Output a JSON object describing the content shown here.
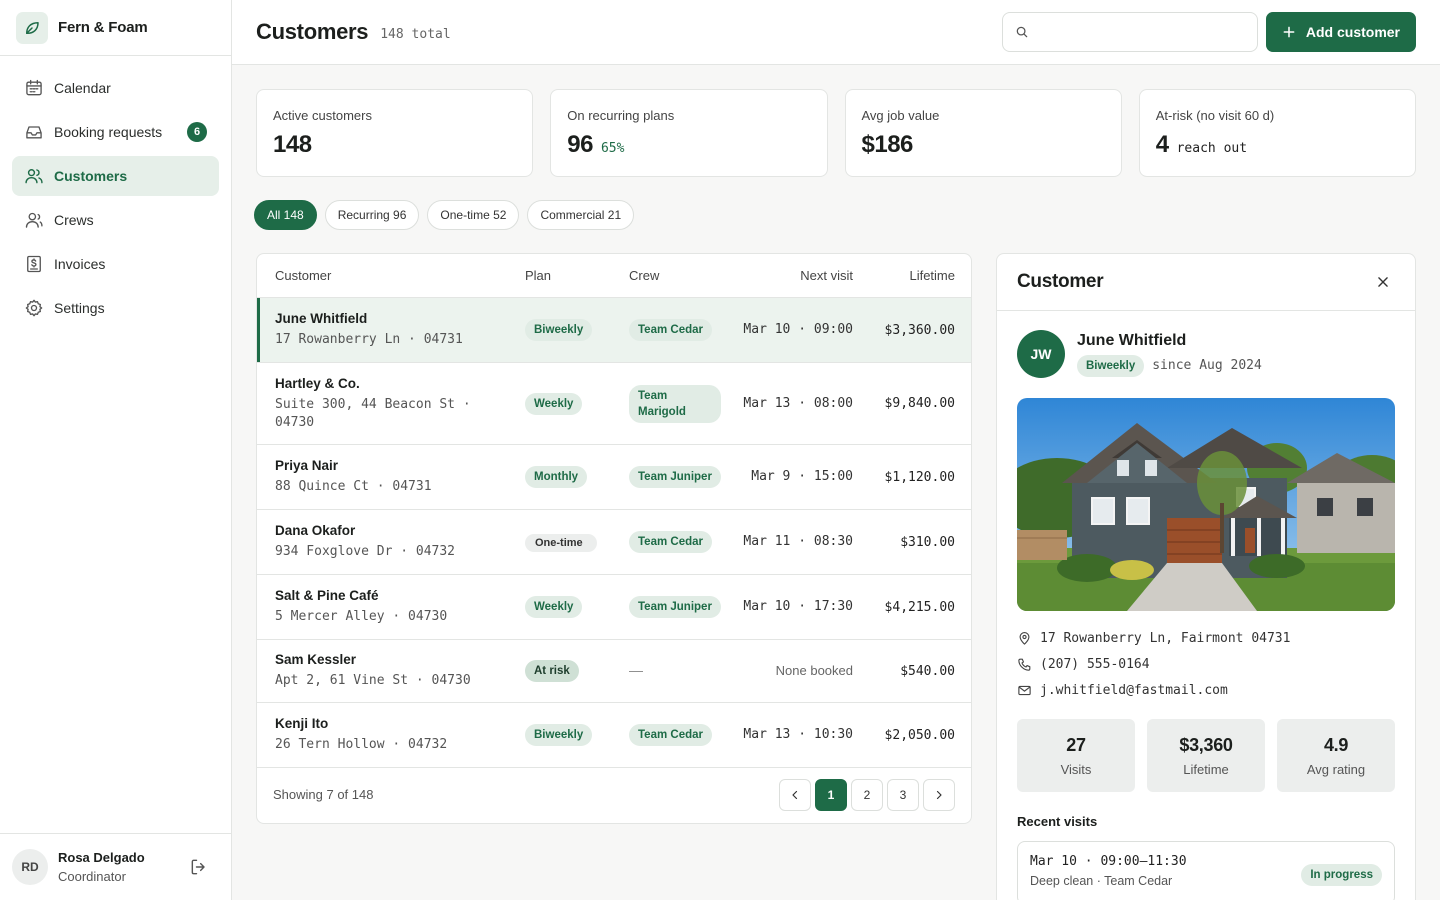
{
  "brand": {
    "name": "Fern & Foam"
  },
  "nav": [
    {
      "label": "Calendar",
      "icon": "calendar-icon"
    },
    {
      "label": "Booking requests",
      "icon": "inbox-icon",
      "badge": "6"
    },
    {
      "label": "Customers",
      "icon": "users-icon",
      "active": true
    },
    {
      "label": "Crews",
      "icon": "crew-icon"
    },
    {
      "label": "Invoices",
      "icon": "invoice-icon"
    },
    {
      "label": "Settings",
      "icon": "gear-icon"
    }
  ],
  "user": {
    "initials": "RD",
    "name": "Rosa Delgado",
    "role": "Coordinator"
  },
  "header": {
    "title": "Customers",
    "count": "148 total",
    "search_placeholder": "",
    "add_label": "Add customer"
  },
  "stats": [
    {
      "label": "Active customers",
      "value": "148",
      "sub": ""
    },
    {
      "label": "On recurring plans",
      "value": "96",
      "sub": "65%"
    },
    {
      "label": "Avg job value",
      "value": "$186",
      "sub": ""
    },
    {
      "label": "At-risk (no visit 60 d)",
      "value": "4",
      "sub": "reach out"
    }
  ],
  "filters": [
    "All 148",
    "Recurring 96",
    "One-time 52",
    "Commercial 21"
  ],
  "table": {
    "columns": {
      "customer": "Customer",
      "plan": "Plan",
      "crew": "Crew",
      "next": "Next visit",
      "lifetime": "Lifetime"
    },
    "rows": [
      {
        "name": "June Whitfield",
        "address": "17 Rowanberry Ln · 04731",
        "plan": "Biweekly",
        "crew": "Team Cedar",
        "next": "Mar 10 · 09:00",
        "lifetime": "$3,360.00"
      },
      {
        "name": "Hartley & Co.",
        "address": "Suite 300, 44 Beacon St · 04730",
        "plan": "Weekly",
        "crew": "Team Marigold",
        "next": "Mar 13 · 08:00",
        "lifetime": "$9,840.00"
      },
      {
        "name": "Priya Nair",
        "address": "88 Quince Ct · 04731",
        "plan": "Monthly",
        "crew": "Team Juniper",
        "next": "Mar 9 · 15:00",
        "lifetime": "$1,120.00"
      },
      {
        "name": "Dana Okafor",
        "address": "934 Foxglove Dr · 04732",
        "plan": "One-time",
        "crew": "Team Cedar",
        "next": "Mar 11 · 08:30",
        "lifetime": "$310.00"
      },
      {
        "name": "Salt & Pine Café",
        "address": "5 Mercer Alley · 04730",
        "plan": "Weekly",
        "crew": "Team Juniper",
        "next": "Mar 10 · 17:30",
        "lifetime": "$4,215.00"
      },
      {
        "name": "Sam Kessler",
        "address": "Apt 2, 61 Vine St · 04730",
        "plan": "At risk",
        "crew": "—",
        "next": "None booked",
        "lifetime": "$540.00"
      },
      {
        "name": "Kenji Ito",
        "address": "26 Tern Hollow · 04732",
        "plan": "Biweekly",
        "crew": "Team Cedar",
        "next": "Mar 13 · 10:30",
        "lifetime": "$2,050.00"
      }
    ],
    "footer": "Showing 7 of 148",
    "pages": [
      "1",
      "2",
      "3"
    ],
    "current_page": "1"
  },
  "panel": {
    "title": "Customer",
    "initials": "JW",
    "name": "June Whitfield",
    "plan": "Biweekly",
    "since": "since Aug 2024",
    "address": "17 Rowanberry Ln, Fairmont 04731",
    "phone": "(207) 555-0164",
    "email": "j.whitfield@fastmail.com",
    "stats": [
      {
        "value": "27",
        "label": "Visits"
      },
      {
        "value": "$3,360",
        "label": "Lifetime"
      },
      {
        "value": "4.9",
        "label": "Avg rating"
      }
    ],
    "recent_title": "Recent visits",
    "visits": [
      {
        "when": "Mar 10 · 09:00–11:30",
        "what": "Deep clean · Team Cedar",
        "status": "In progress"
      }
    ]
  },
  "colors": {
    "accent": "#1e6b47",
    "accent_soft": "#e6efe9",
    "border": "#e3e5e3"
  }
}
